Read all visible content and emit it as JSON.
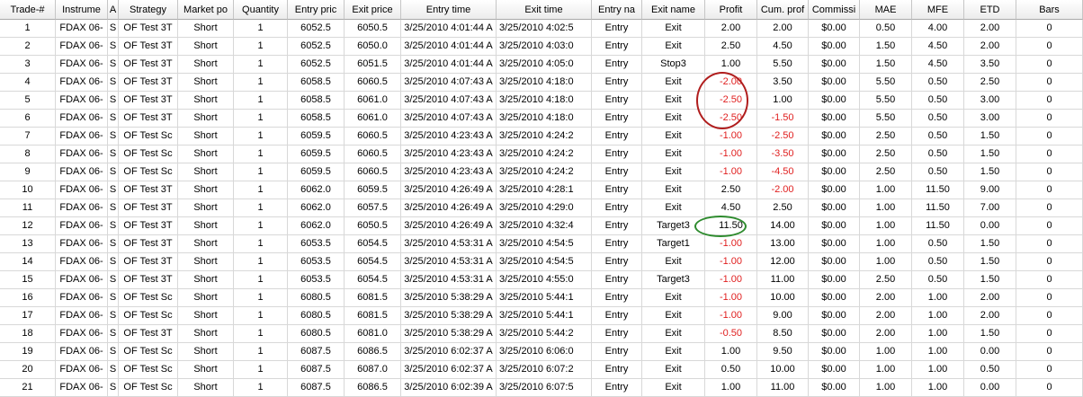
{
  "columns": [
    "Trade-#",
    "Instrume",
    "A",
    "Strategy",
    "Market po",
    "Quantity",
    "Entry pric",
    "Exit price",
    "Entry time",
    "Exit time",
    "Entry na",
    "Exit name",
    "Profit",
    "Cum. prof",
    "Commissi",
    "MAE",
    "MFE",
    "ETD",
    "Bars"
  ],
  "rows": [
    [
      "1",
      "FDAX 06-",
      "S",
      "OF Test 3T",
      "Short",
      "1",
      "6052.5",
      "6050.5",
      "3/25/2010 4:01:44 A",
      "3/25/2010 4:02:5",
      "Entry",
      "Exit",
      "2.00",
      "2.00",
      "$0.00",
      "0.50",
      "4.00",
      "2.00",
      "0"
    ],
    [
      "2",
      "FDAX 06-",
      "S",
      "OF Test 3T",
      "Short",
      "1",
      "6052.5",
      "6050.0",
      "3/25/2010 4:01:44 A",
      "3/25/2010 4:03:0",
      "Entry",
      "Exit",
      "2.50",
      "4.50",
      "$0.00",
      "1.50",
      "4.50",
      "2.00",
      "0"
    ],
    [
      "3",
      "FDAX 06-",
      "S",
      "OF Test 3T",
      "Short",
      "1",
      "6052.5",
      "6051.5",
      "3/25/2010 4:01:44 A",
      "3/25/2010 4:05:0",
      "Entry",
      "Stop3",
      "1.00",
      "5.50",
      "$0.00",
      "1.50",
      "4.50",
      "3.50",
      "0"
    ],
    [
      "4",
      "FDAX 06-",
      "S",
      "OF Test 3T",
      "Short",
      "1",
      "6058.5",
      "6060.5",
      "3/25/2010 4:07:43 A",
      "3/25/2010 4:18:0",
      "Entry",
      "Exit",
      "-2.00",
      "3.50",
      "$0.00",
      "5.50",
      "0.50",
      "2.50",
      "0"
    ],
    [
      "5",
      "FDAX 06-",
      "S",
      "OF Test 3T",
      "Short",
      "1",
      "6058.5",
      "6061.0",
      "3/25/2010 4:07:43 A",
      "3/25/2010 4:18:0",
      "Entry",
      "Exit",
      "-2.50",
      "1.00",
      "$0.00",
      "5.50",
      "0.50",
      "3.00",
      "0"
    ],
    [
      "6",
      "FDAX 06-",
      "S",
      "OF Test 3T",
      "Short",
      "1",
      "6058.5",
      "6061.0",
      "3/25/2010 4:07:43 A",
      "3/25/2010 4:18:0",
      "Entry",
      "Exit",
      "-2.50",
      "-1.50",
      "$0.00",
      "5.50",
      "0.50",
      "3.00",
      "0"
    ],
    [
      "7",
      "FDAX 06-",
      "S",
      "OF Test Sc",
      "Short",
      "1",
      "6059.5",
      "6060.5",
      "3/25/2010 4:23:43 A",
      "3/25/2010 4:24:2",
      "Entry",
      "Exit",
      "-1.00",
      "-2.50",
      "$0.00",
      "2.50",
      "0.50",
      "1.50",
      "0"
    ],
    [
      "8",
      "FDAX 06-",
      "S",
      "OF Test Sc",
      "Short",
      "1",
      "6059.5",
      "6060.5",
      "3/25/2010 4:23:43 A",
      "3/25/2010 4:24:2",
      "Entry",
      "Exit",
      "-1.00",
      "-3.50",
      "$0.00",
      "2.50",
      "0.50",
      "1.50",
      "0"
    ],
    [
      "9",
      "FDAX 06-",
      "S",
      "OF Test Sc",
      "Short",
      "1",
      "6059.5",
      "6060.5",
      "3/25/2010 4:23:43 A",
      "3/25/2010 4:24:2",
      "Entry",
      "Exit",
      "-1.00",
      "-4.50",
      "$0.00",
      "2.50",
      "0.50",
      "1.50",
      "0"
    ],
    [
      "10",
      "FDAX 06-",
      "S",
      "OF Test 3T",
      "Short",
      "1",
      "6062.0",
      "6059.5",
      "3/25/2010 4:26:49 A",
      "3/25/2010 4:28:1",
      "Entry",
      "Exit",
      "2.50",
      "-2.00",
      "$0.00",
      "1.00",
      "11.50",
      "9.00",
      "0"
    ],
    [
      "11",
      "FDAX 06-",
      "S",
      "OF Test 3T",
      "Short",
      "1",
      "6062.0",
      "6057.5",
      "3/25/2010 4:26:49 A",
      "3/25/2010 4:29:0",
      "Entry",
      "Exit",
      "4.50",
      "2.50",
      "$0.00",
      "1.00",
      "11.50",
      "7.00",
      "0"
    ],
    [
      "12",
      "FDAX 06-",
      "S",
      "OF Test 3T",
      "Short",
      "1",
      "6062.0",
      "6050.5",
      "3/25/2010 4:26:49 A",
      "3/25/2010 4:32:4",
      "Entry",
      "Target3",
      "11.50",
      "14.00",
      "$0.00",
      "1.00",
      "11.50",
      "0.00",
      "0"
    ],
    [
      "13",
      "FDAX 06-",
      "S",
      "OF Test 3T",
      "Short",
      "1",
      "6053.5",
      "6054.5",
      "3/25/2010 4:53:31 A",
      "3/25/2010 4:54:5",
      "Entry",
      "Target1",
      "-1.00",
      "13.00",
      "$0.00",
      "1.00",
      "0.50",
      "1.50",
      "0"
    ],
    [
      "14",
      "FDAX 06-",
      "S",
      "OF Test 3T",
      "Short",
      "1",
      "6053.5",
      "6054.5",
      "3/25/2010 4:53:31 A",
      "3/25/2010 4:54:5",
      "Entry",
      "Exit",
      "-1.00",
      "12.00",
      "$0.00",
      "1.00",
      "0.50",
      "1.50",
      "0"
    ],
    [
      "15",
      "FDAX 06-",
      "S",
      "OF Test 3T",
      "Short",
      "1",
      "6053.5",
      "6054.5",
      "3/25/2010 4:53:31 A",
      "3/25/2010 4:55:0",
      "Entry",
      "Target3",
      "-1.00",
      "11.00",
      "$0.00",
      "2.50",
      "0.50",
      "1.50",
      "0"
    ],
    [
      "16",
      "FDAX 06-",
      "S",
      "OF Test Sc",
      "Short",
      "1",
      "6080.5",
      "6081.5",
      "3/25/2010 5:38:29 A",
      "3/25/2010 5:44:1",
      "Entry",
      "Exit",
      "-1.00",
      "10.00",
      "$0.00",
      "2.00",
      "1.00",
      "2.00",
      "0"
    ],
    [
      "17",
      "FDAX 06-",
      "S",
      "OF Test Sc",
      "Short",
      "1",
      "6080.5",
      "6081.5",
      "3/25/2010 5:38:29 A",
      "3/25/2010 5:44:1",
      "Entry",
      "Exit",
      "-1.00",
      "9.00",
      "$0.00",
      "2.00",
      "1.00",
      "2.00",
      "0"
    ],
    [
      "18",
      "FDAX 06-",
      "S",
      "OF Test 3T",
      "Short",
      "1",
      "6080.5",
      "6081.0",
      "3/25/2010 5:38:29 A",
      "3/25/2010 5:44:2",
      "Entry",
      "Exit",
      "-0.50",
      "8.50",
      "$0.00",
      "2.00",
      "1.00",
      "1.50",
      "0"
    ],
    [
      "19",
      "FDAX 06-",
      "S",
      "OF Test Sc",
      "Short",
      "1",
      "6087.5",
      "6086.5",
      "3/25/2010 6:02:37 A",
      "3/25/2010 6:06:0",
      "Entry",
      "Exit",
      "1.00",
      "9.50",
      "$0.00",
      "1.00",
      "1.00",
      "0.00",
      "0"
    ],
    [
      "20",
      "FDAX 06-",
      "S",
      "OF Test Sc",
      "Short",
      "1",
      "6087.5",
      "6087.0",
      "3/25/2010 6:02:37 A",
      "3/25/2010 6:07:2",
      "Entry",
      "Exit",
      "0.50",
      "10.00",
      "$0.00",
      "1.00",
      "1.00",
      "0.50",
      "0"
    ],
    [
      "21",
      "FDAX 06-",
      "S",
      "OF Test Sc",
      "Short",
      "1",
      "6087.5",
      "6086.5",
      "3/25/2010 6:02:39 A",
      "3/25/2010 6:07:5",
      "Entry",
      "Exit",
      "1.00",
      "11.00",
      "$0.00",
      "1.00",
      "1.00",
      "0.00",
      "0"
    ]
  ],
  "colors": {
    "negative": "#e02020",
    "highlight_loss": "#b01d1d",
    "highlight_win": "#2e8b2e"
  }
}
